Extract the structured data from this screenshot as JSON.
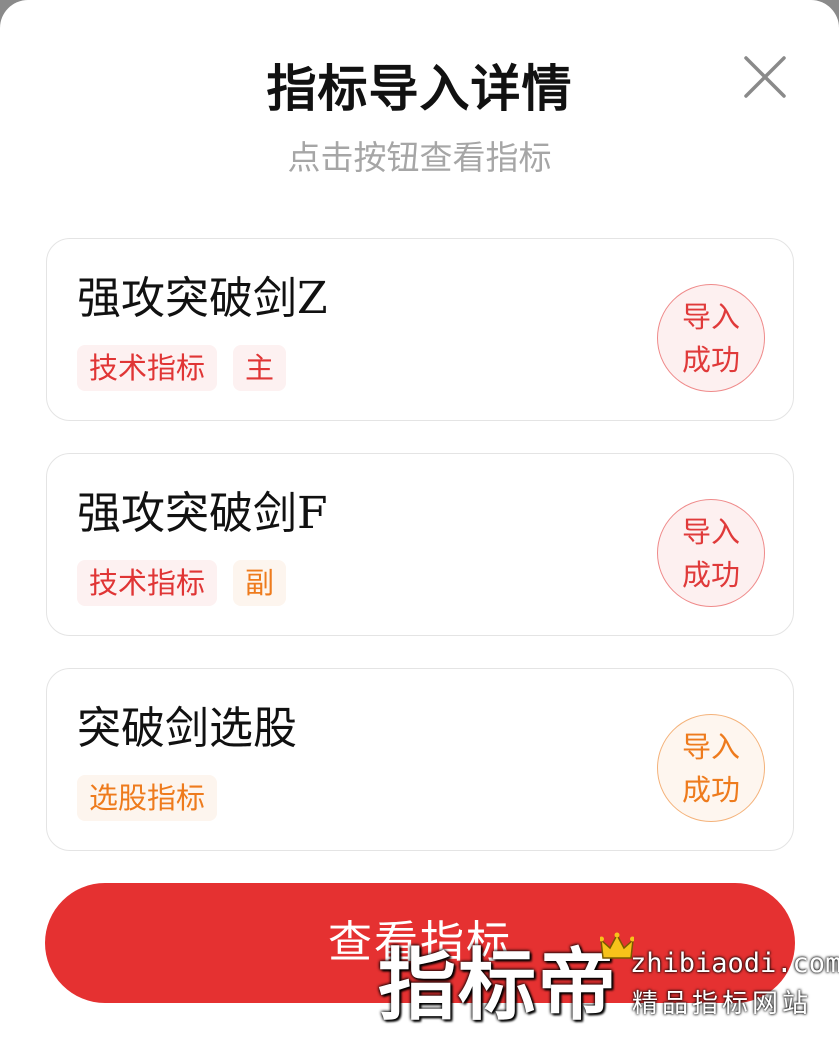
{
  "dialog": {
    "title": "指标导入详情",
    "subtitle": "点击按钮查看指标"
  },
  "icons": {
    "close": "close-icon",
    "crown": "crown-icon"
  },
  "items": [
    {
      "name": "强攻突破剑Z",
      "tags": [
        {
          "label": "技术指标",
          "tone": "red"
        },
        {
          "label": "主",
          "tone": "red"
        }
      ],
      "status_line1": "导入",
      "status_line2": "成功",
      "status_tone": "red"
    },
    {
      "name": "强攻突破剑F",
      "tags": [
        {
          "label": "技术指标",
          "tone": "red"
        },
        {
          "label": "副",
          "tone": "orange"
        }
      ],
      "status_line1": "导入",
      "status_line2": "成功",
      "status_tone": "red"
    },
    {
      "name": "突破剑选股",
      "tags": [
        {
          "label": "选股指标",
          "tone": "orange"
        }
      ],
      "status_line1": "导入",
      "status_line2": "成功",
      "status_tone": "orange"
    }
  ],
  "primary_button": {
    "label": "查看指标"
  },
  "watermark": {
    "brand": "指标帝",
    "domain": "zhibiaodi.com",
    "slogan": "精品指标网站"
  },
  "colors": {
    "primary": "#e53131",
    "tag_red_text": "#e03535",
    "tag_orange_text": "#ee7b1d",
    "subtitle": "#a6a6a6"
  }
}
